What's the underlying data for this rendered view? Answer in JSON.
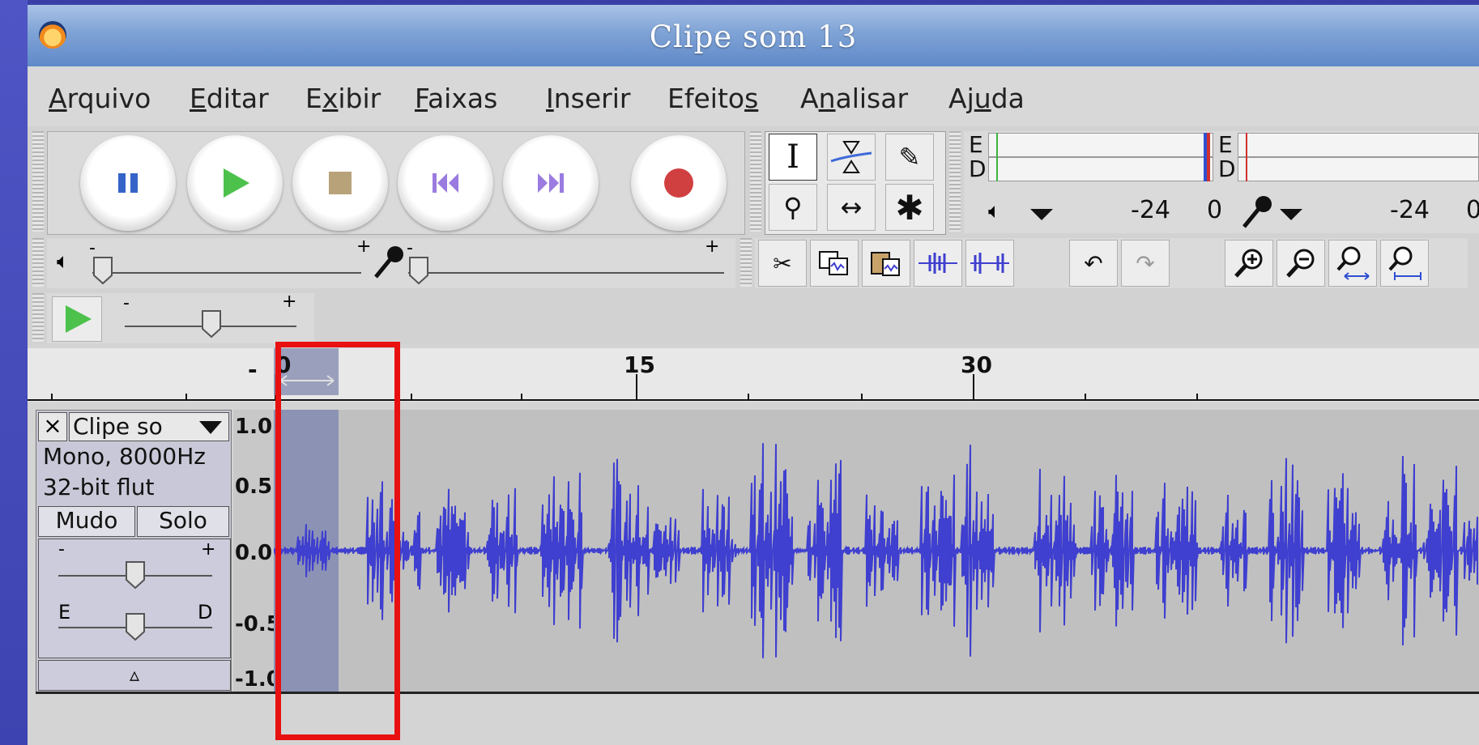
{
  "window": {
    "title": "Clipe som 13"
  },
  "menu": [
    {
      "label": "Arquivo",
      "accel_index": 0
    },
    {
      "label": "Editar",
      "accel_index": 0
    },
    {
      "label": "Exibir",
      "accel_index": 1
    },
    {
      "label": "Faixas",
      "accel_index": 0
    },
    {
      "label": "Inserir",
      "accel_index": 0
    },
    {
      "label": "Efeitos",
      "accel_index": 6
    },
    {
      "label": "Analisar",
      "accel_index": 1
    },
    {
      "label": "Ajuda",
      "accel_index": 2
    }
  ],
  "meter": {
    "play_l": "E",
    "play_r": "D",
    "rec_l": "E",
    "rec_r": "D",
    "scale_a": "-24",
    "scale_b": "0",
    "scale_c": "-24",
    "scale_d": "0"
  },
  "mixer": {
    "minus": "-",
    "plus": "+"
  },
  "ruler": {
    "t0": "0",
    "t15": "15",
    "t30": "30",
    "minus": "-"
  },
  "track": {
    "close": "×",
    "name": "Clipe so",
    "format": "Mono, 8000Hz",
    "sample": "32-bit flut",
    "mute": "Mudo",
    "solo": "Solo",
    "gain_minus": "-",
    "gain_plus": "+",
    "pan_left": "E",
    "pan_right": "D",
    "collapse": "▵"
  },
  "vscale": {
    "p10": "1.0",
    "p05": "0.5",
    "z": "0.0",
    "m05": "-0.5",
    "m10": "-1.0"
  },
  "colors": {
    "wave": "#3f3fd0",
    "selection": "#8c92b4",
    "highlight_box": "#e81010"
  }
}
